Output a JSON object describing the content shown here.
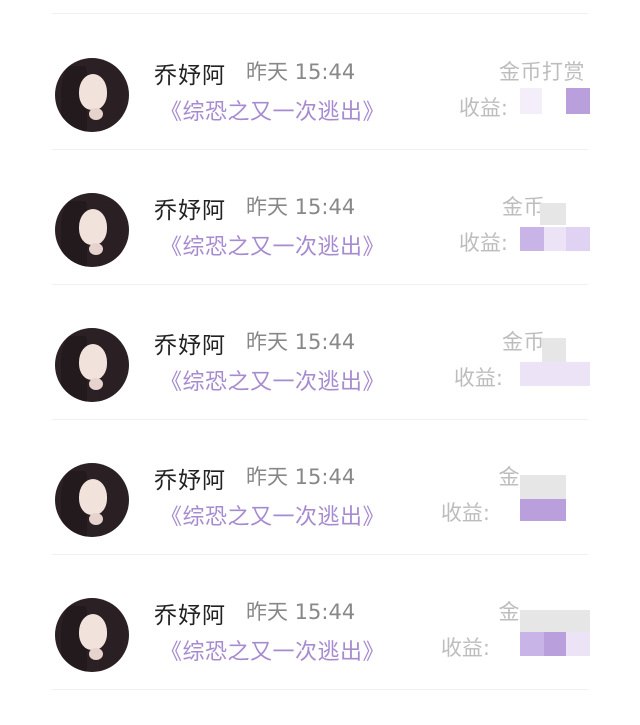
{
  "rows": [
    {
      "name": "乔妤阿",
      "time": "昨天 15:44",
      "book": "《综恐之又一次逃出》",
      "reward_label": "金币打赏",
      "income_label": "收益:"
    },
    {
      "name": "乔妤阿",
      "time": "昨天 15:44",
      "book": "《综恐之又一次逃出》",
      "reward_label": "金币",
      "income_label": "收益:"
    },
    {
      "name": "乔妤阿",
      "time": "昨天 15:44",
      "book": "《综恐之又一次逃出》",
      "reward_label": "金币",
      "income_label": "收益:"
    },
    {
      "name": "乔妤阿",
      "time": "昨天 15:44",
      "book": "《综恐之又一次逃出》",
      "reward_label": "金",
      "income_label": "收益:"
    },
    {
      "name": "乔妤阿",
      "time": "昨天 15:44",
      "book": "《综恐之又一次逃出》",
      "reward_label": "金",
      "income_label": "收益:"
    }
  ],
  "colors": {
    "name": "#222222",
    "time": "#888888",
    "book_title": "#a78bd0",
    "muted": "#bdbdbd",
    "mosaic_purple": "#b9a0dd",
    "mosaic_light": "#ece4f6",
    "mosaic_grey": "#e6e6e6"
  },
  "icons": {
    "avatar": "user-avatar-photo"
  }
}
